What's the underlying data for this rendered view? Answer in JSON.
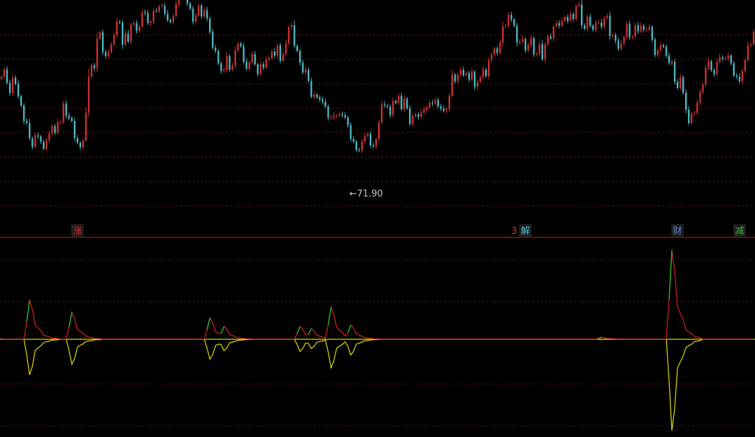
{
  "chart_data": [
    {
      "type": "candlestick",
      "panel": "price",
      "grid": true,
      "grid_style": "dotted-horizontal",
      "colors": {
        "up": "#c8322f",
        "down": "#4bb7c4",
        "grid": "#8a1a1a",
        "background": "#000000"
      },
      "ylim": [
        66,
        108
      ],
      "x_count": 268,
      "close": [
        94.2,
        95.6,
        93.0,
        91.0,
        94.0,
        92.8,
        90.4,
        88.6,
        85.6,
        85.2,
        82.2,
        80.6,
        82.8,
        82.6,
        81.6,
        80.2,
        81.8,
        83.2,
        84.6,
        83.3,
        85.4,
        85.4,
        89.0,
        86.6,
        86.2,
        85.6,
        82.3,
        81.4,
        80.5,
        81.8,
        87.2,
        94.2,
        96.4,
        95.8,
        101.6,
        102.8,
        99.0,
        98.2,
        99.0,
        100.5,
        102.3,
        104.9,
        104.7,
        100.4,
        102.6,
        101.0,
        104.3,
        104.6,
        103.1,
        104.0,
        106.7,
        106.5,
        104.6,
        104.9,
        107.0,
        106.9,
        107.9,
        108.0,
        106.4,
        105.2,
        104.8,
        106.0,
        108.3,
        110.0,
        111.2,
        109.7,
        108.4,
        107.4,
        104.9,
        106.1,
        108.0,
        105.9,
        107.1,
        105.5,
        102.9,
        99.8,
        99.2,
        96.8,
        95.3,
        95.5,
        98.2,
        95.6,
        96.4,
        99.3,
        100.6,
        100.1,
        97.1,
        95.7,
        97.0,
        98.6,
        96.6,
        94.7,
        96.6,
        96.0,
        97.5,
        97.8,
        99.1,
        98.3,
        100.3,
        97.3,
        98.6,
        100.7,
        103.8,
        104.2,
        100.2,
        99.2,
        96.9,
        95.0,
        95.6,
        93.4,
        90.3,
        90.7,
        90.2,
        89.8,
        89.3,
        88.4,
        86.2,
        86.3,
        86.6,
        86.6,
        86.9,
        86.7,
        86.3,
        84.8,
        82.1,
        81.6,
        80.0,
        79.9,
        81.6,
        82.7,
        83.1,
        80.9,
        80.7,
        82.1,
        85.3,
        88.8,
        88.6,
        88.4,
        86.8,
        89.5,
        89.1,
        90.5,
        87.9,
        89.9,
        88.1,
        85.0,
        86.6,
        86.9,
        86.4,
        87.2,
        87.8,
        88.2,
        89.1,
        89.0,
        89.7,
        88.4,
        88.0,
        87.6,
        87.9,
        90.5,
        94.6,
        93.3,
        94.6,
        95.5,
        94.5,
        94.9,
        93.6,
        95.2,
        92.2,
        93.2,
        94.1,
        95.6,
        94.3,
        97.4,
        98.5,
        99.7,
        98.8,
        100.8,
        104.0,
        104.1,
        106.2,
        105.3,
        104.1,
        100.8,
        101.0,
        101.5,
        99.3,
        100.4,
        101.7,
        98.5,
        98.6,
        100.5,
        97.6,
        100.5,
        102.0,
        101.6,
        104.0,
        104.6,
        104.1,
        105.0,
        105.8,
        105.0,
        106.4,
        105.4,
        107.9,
        108.2,
        104.2,
        103.5,
        105.8,
        104.1,
        103.3,
        104.7,
        104.7,
        103.9,
        105.6,
        106.0,
        102.1,
        102.3,
        101.2,
        99.6,
        100.6,
        101.9,
        104.4,
        101.9,
        102.0,
        104.2,
        103.0,
        104.1,
        103.3,
        103.3,
        103.9,
        101.4,
        98.4,
        99.3,
        100.3,
        100.0,
        98.3,
        96.8,
        97.1,
        93.2,
        92.0,
        94.1,
        91.1,
        87.8,
        85.2,
        87.1,
        87.2,
        89.2,
        91.2,
        92.7,
        95.9,
        97.2,
        95.5,
        94.7,
        97.1,
        98.0,
        97.7,
        97.7,
        98.3,
        96.8,
        94.4,
        94.2,
        93.3,
        95.3,
        97.4,
        100.3,
        100.5,
        102.9,
        104.8,
        106.6,
        106.6,
        103.9
      ],
      "annotation": {
        "text": "←71.90",
        "value": 71.9,
        "x_index": 124
      },
      "event_markers": [
        {
          "label": "涨",
          "x_index": 27,
          "color": "#e03030"
        },
        {
          "label": "3",
          "x_index": 182,
          "color": "#e03030"
        },
        {
          "label": "解",
          "x_index": 186,
          "color": "#5ab8d8"
        },
        {
          "label": "财",
          "x_index": 240,
          "color": "#5a8fd8"
        },
        {
          "label": "减",
          "x_index": 262,
          "color": "#3bbf3b"
        }
      ]
    },
    {
      "type": "line",
      "panel": "indicator",
      "grid": true,
      "colors": {
        "baseline": "#d8d800",
        "red": "#e02020",
        "green": "#20c020",
        "yellow": "#e0e000"
      },
      "ylim": [
        -13.5,
        13.5
      ],
      "spikes": [
        {
          "x_index": 10,
          "up": 5.5,
          "down": 5.0
        },
        {
          "x_index": 25,
          "up": 3.8,
          "down": 3.5
        },
        {
          "x_index": 74,
          "up": 3.0,
          "down": 2.8
        },
        {
          "x_index": 79,
          "up": 1.8,
          "down": 1.6
        },
        {
          "x_index": 106,
          "up": 1.8,
          "down": 1.7
        },
        {
          "x_index": 110,
          "up": 1.5,
          "down": 1.3
        },
        {
          "x_index": 117,
          "up": 4.5,
          "down": 4.0
        },
        {
          "x_index": 124,
          "up": 2.0,
          "down": 2.2
        },
        {
          "x_index": 213,
          "up": 0.3,
          "down": 0.0
        },
        {
          "x_index": 238,
          "up": 12.5,
          "down": 12.8
        }
      ]
    }
  ]
}
